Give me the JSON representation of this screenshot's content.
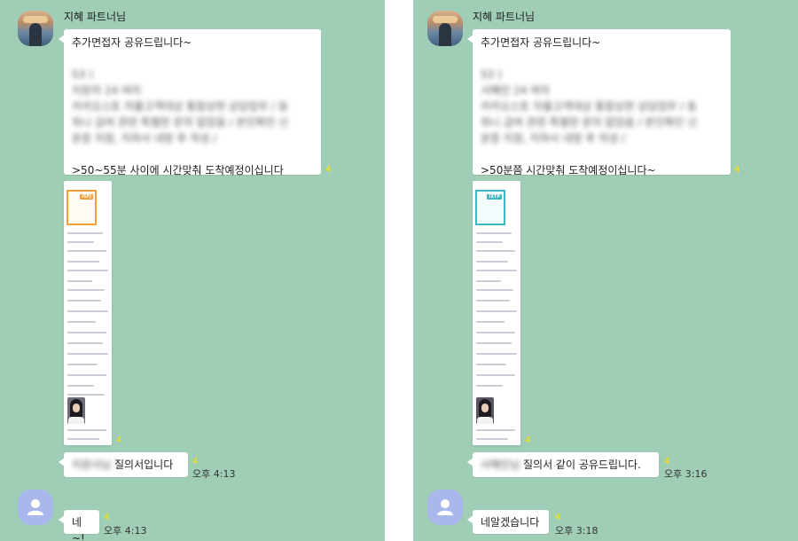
{
  "chats": [
    {
      "sender": "지혜 파트너님",
      "message1": {
        "line1": "추가면접자 공유드립니다~",
        "blur1": "S3 )",
        "blur2": "지원자 24 여자",
        "blur3": "카카오스토 자율고객대상 통합상현 상담업무 / 동",
        "blur4": "위니 급여 관련 특별한 문의 없었음 / 본인확인 신",
        "blur5": "분증 지참, 지하사 내방 후 작성 /",
        "line_last": ">50~55분 사이에 시간맞춰 도착예정이십니다",
        "unread": "4"
      },
      "doc": {
        "badge": "ISFJ",
        "accent": "#f29d38",
        "unread": "4"
      },
      "message2": {
        "blur_name": "지원서님",
        "text": "질의서입니다",
        "unread": "4",
        "time": "오후 4:13"
      },
      "reply": {
        "text": "네~!",
        "unread": "4",
        "time": "오후 4:13"
      }
    },
    {
      "sender": "지혜 파트너님",
      "message1": {
        "line1": "추가면접자 공유드립니다~",
        "blur1": "S3 )",
        "blur2": "서혜민 24 여자",
        "blur3": "카카오스토 자율고객대상 통합상현 상담업무 / 동",
        "blur4": "위니 급여 관련 특별한 문의 없었음 / 본인확인 신",
        "blur5": "분증 지참, 지하사 내방 후 작성 /",
        "line_last": ">50분쯤 시간맞춰 도착예정이십니다~",
        "unread": "4"
      },
      "doc": {
        "badge": "ISTP",
        "accent": "#39b7c4",
        "unread": "4"
      },
      "message2": {
        "blur_name": "서혜민님",
        "text": "질의서 같이 공유드립니다.",
        "unread": "4",
        "time": "오후 3:16"
      },
      "reply": {
        "text": "네알겠습니다",
        "unread": "4",
        "time": "오후 3:18"
      }
    }
  ],
  "colors": {
    "chat_background": "#9fcdb6",
    "bubble": "#ffffff",
    "unread": "#f7e600",
    "default_avatar": "#a9b7eb"
  },
  "icons": {
    "avatar_photo": "profile-photo-icon",
    "avatar_default": "default-user-icon"
  }
}
